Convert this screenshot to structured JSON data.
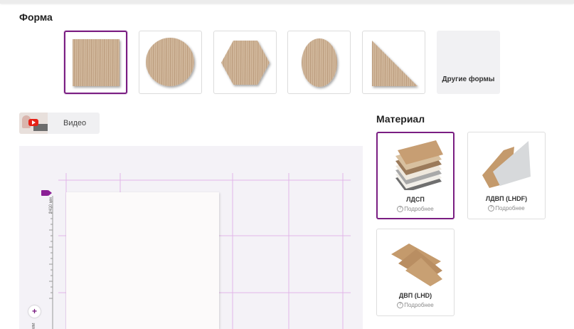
{
  "shape_section": {
    "title": "Форма",
    "shapes": [
      {
        "name": "square",
        "selected": true
      },
      {
        "name": "circle",
        "selected": false
      },
      {
        "name": "hexagon",
        "selected": false
      },
      {
        "name": "oval",
        "selected": false
      },
      {
        "name": "triangle",
        "selected": false
      }
    ],
    "other_label": "Другие формы"
  },
  "video": {
    "label": "Видео"
  },
  "canvas": {
    "dimension_label": "2400 мм",
    "side_label": "мм",
    "zoom_icon": "+"
  },
  "material_section": {
    "title": "Материал",
    "materials": [
      {
        "name": "ЛДСП",
        "more": "Подробнее",
        "selected": true
      },
      {
        "name": "ЛДВП (LHDF)",
        "more": "Подробнее",
        "selected": false
      },
      {
        "name": "ДВП (LHD)",
        "more": "Подробнее",
        "selected": false
      }
    ]
  },
  "colors": {
    "accent": "#7a1e82",
    "wood": "#c9ab8c"
  }
}
